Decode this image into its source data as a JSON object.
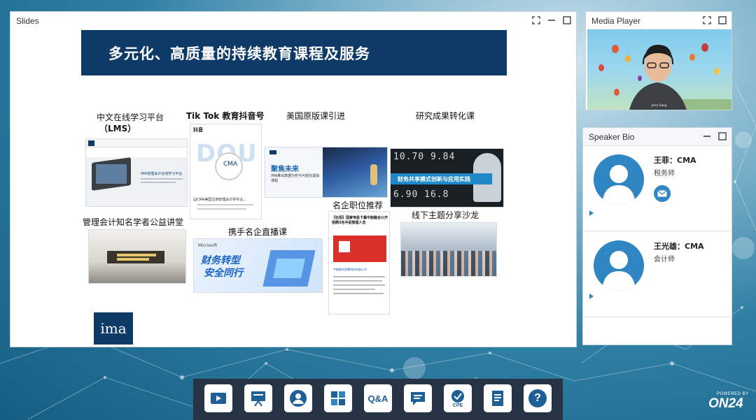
{
  "windows": {
    "slides_title": "Slides",
    "media_title": "Media Player",
    "speaker_title": "Speaker Bio"
  },
  "slide": {
    "heading": "多元化、高质量的持续教育课程及服务",
    "labels": {
      "lms_line1": "中文在线学习平台",
      "lms_line2": "（LMS）",
      "tiktok": "Tik Tok 教育抖音号",
      "us_course": "美国原版课引进",
      "research": "研究成果转化课",
      "lecture": "管理会计知名学者公益讲堂",
      "live": "携手名企直播课",
      "jobs": "名企职位推荐",
      "salon": "线下主题分享沙龙"
    },
    "thumbs": {
      "lms_caption": "IMA管理会计在线学习平台",
      "douyin_brand": "抖音",
      "douyin_account": "@CMA美国注册管理会计师专业...",
      "us_course_title": "聚焦未来",
      "us_course_sub": "IMA推出数据分析与可视化基础课程",
      "research_text": "财务共享模式创新与应用实践",
      "live_brand": "Microsoft",
      "live_title_1": "财务转型",
      "live_title_2": "安全同行",
      "jobs_header": "【社招】国家电投下属中能融合公开招聘3名中层管理人员",
      "jobs_company": "中能融合智慧科技有限公司",
      "ima_logo": "ima"
    }
  },
  "media": {
    "caption": "Jerry Gong"
  },
  "speakers": [
    {
      "name": "王菲：CMA",
      "title": "税务师"
    },
    {
      "name": "王光雄：CMA",
      "title": "会计师"
    }
  ],
  "dock": {
    "buttons": [
      {
        "id": "media",
        "icon": "play-icon"
      },
      {
        "id": "slides",
        "icon": "presentation-icon"
      },
      {
        "id": "speaker",
        "icon": "person-icon"
      },
      {
        "id": "resources",
        "icon": "puzzle-icon"
      },
      {
        "id": "qa",
        "icon": "qa-icon",
        "label": "Q&A"
      },
      {
        "id": "chat",
        "icon": "chat-icon"
      },
      {
        "id": "cpe",
        "icon": "cpe-badge-icon",
        "label": "CPE"
      },
      {
        "id": "survey",
        "icon": "document-icon"
      },
      {
        "id": "help",
        "icon": "help-icon",
        "label": "?"
      }
    ]
  },
  "brand": {
    "powered": "POWERED BY",
    "name": "ON24"
  },
  "colors": {
    "banner": "#0e3a68",
    "accent": "#2f86c2",
    "dock": "#263445"
  }
}
